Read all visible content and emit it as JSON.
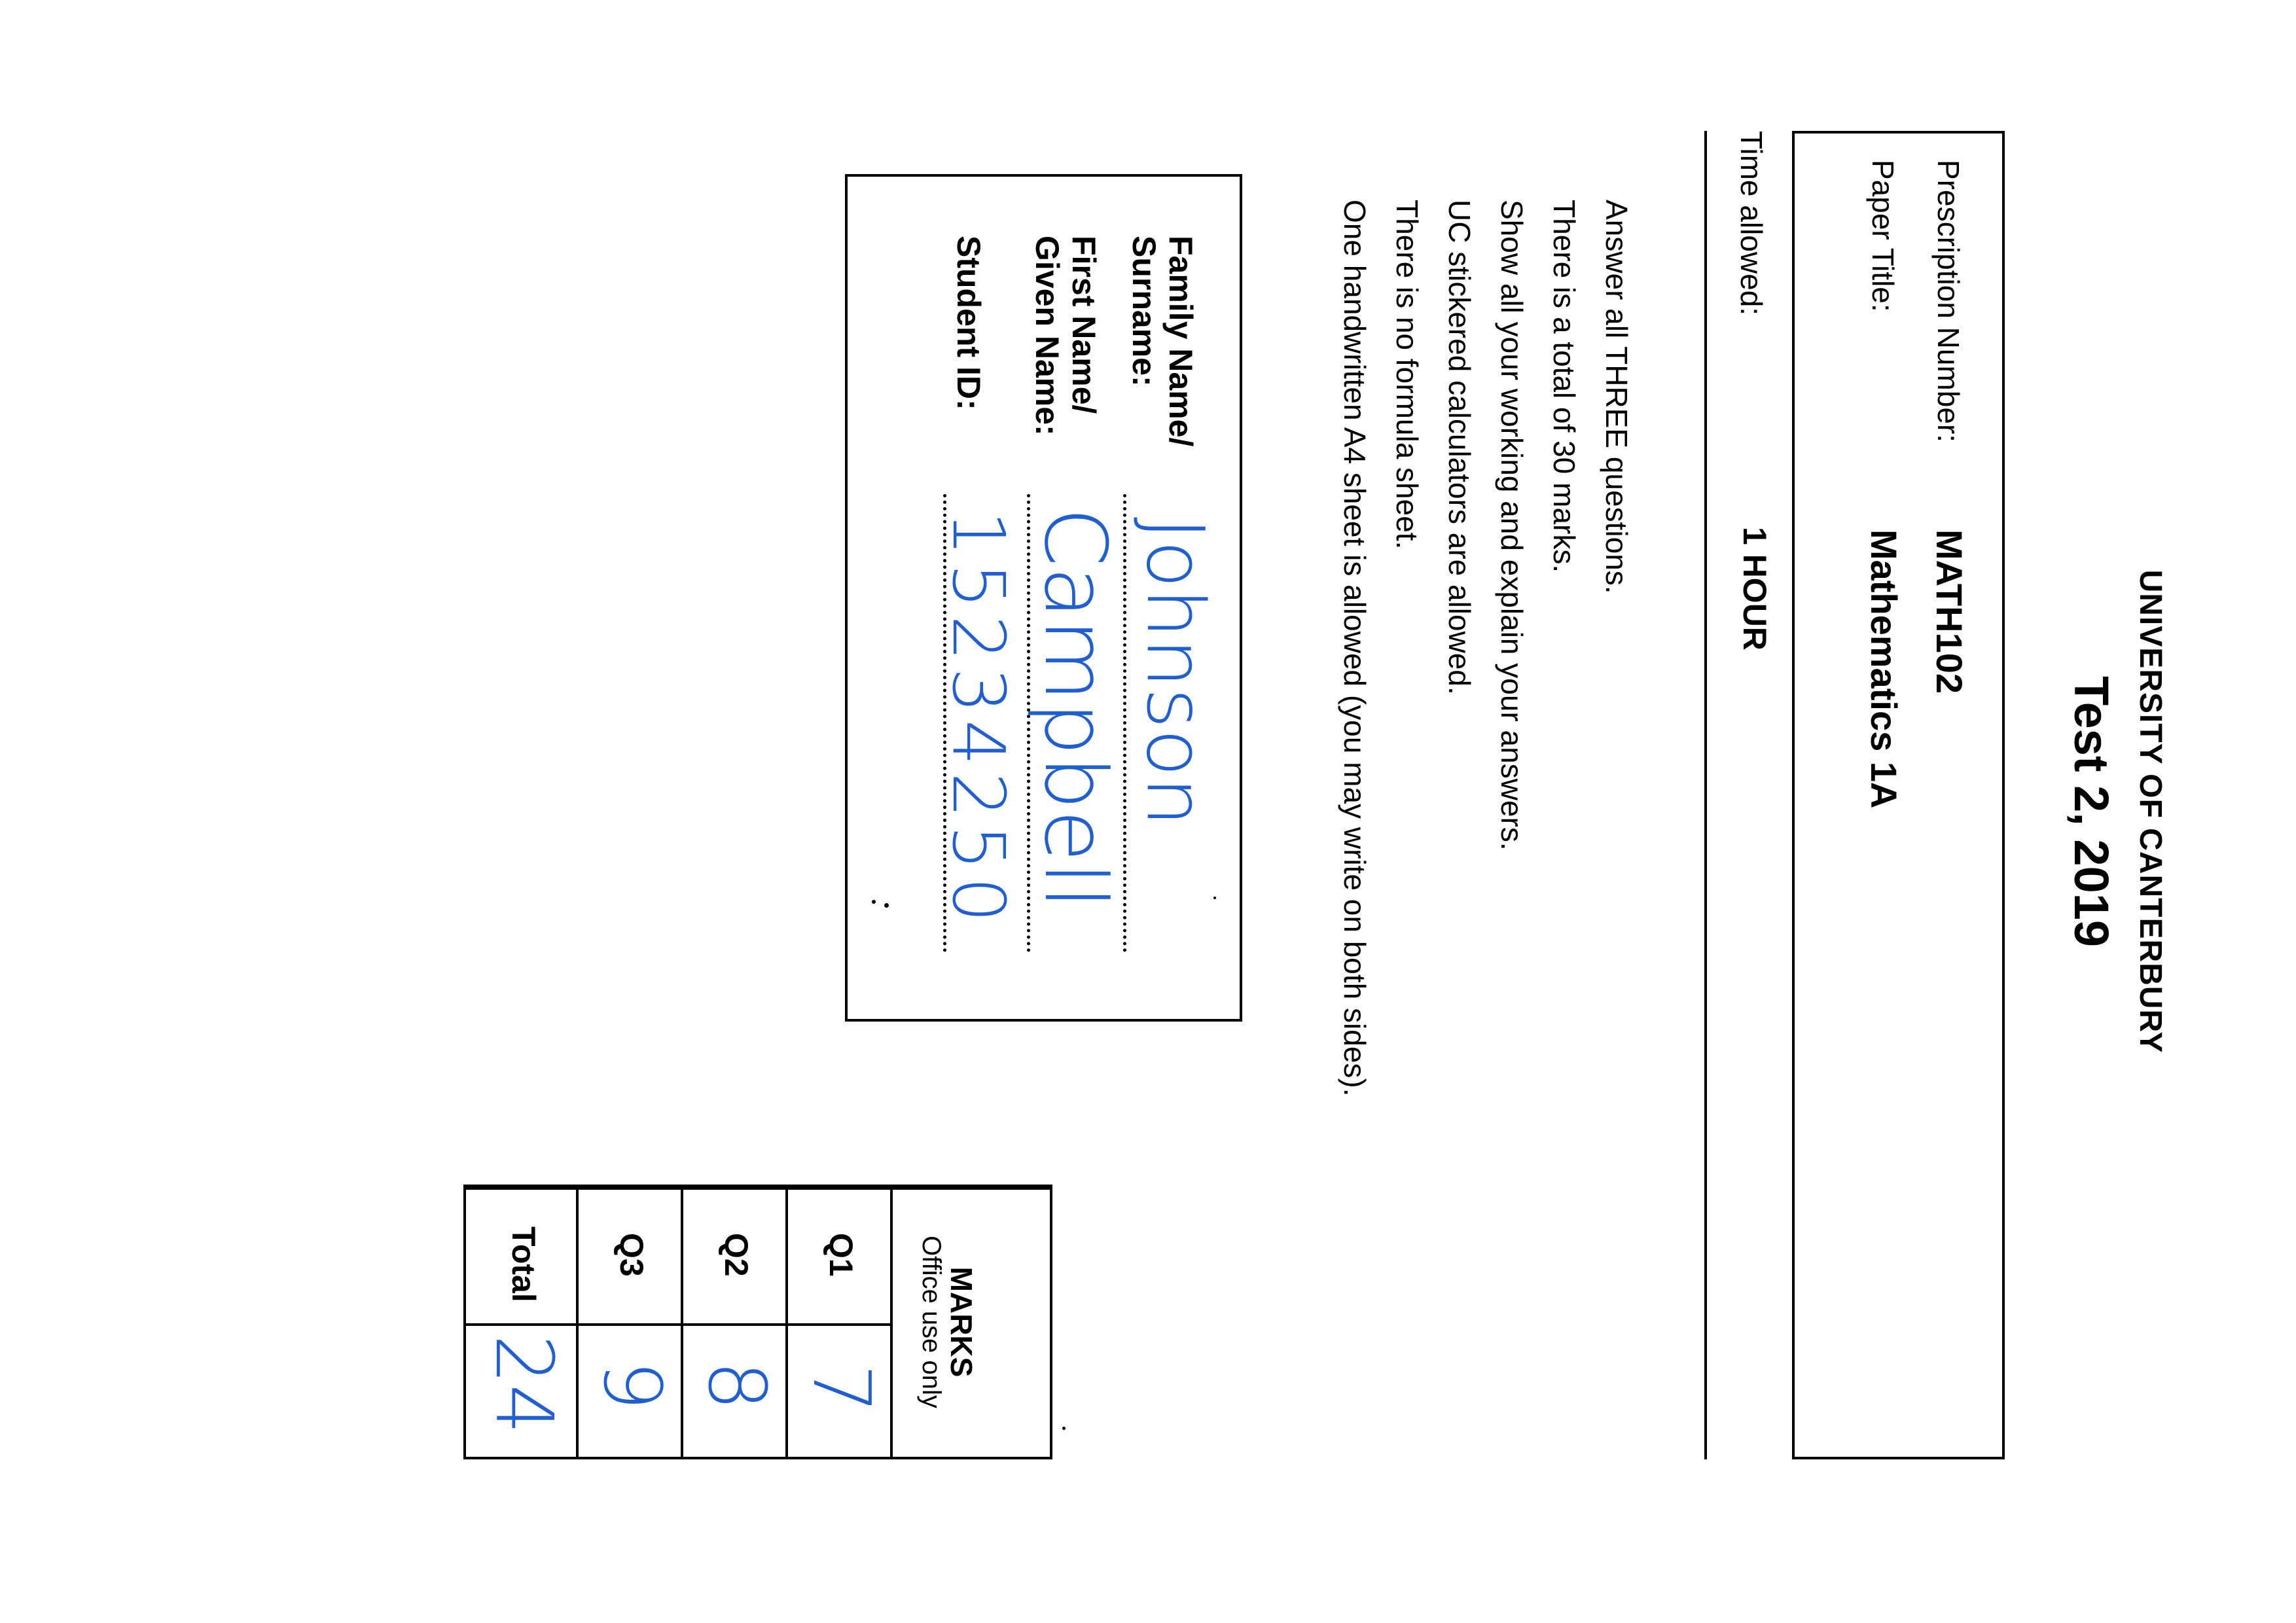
{
  "header": {
    "institution": "UNIVERSITY OF CANTERBURY",
    "test_title": "Test 2, 2019"
  },
  "course": {
    "prescription_label": "Prescription Number:",
    "prescription_value": "MATH102",
    "paper_title_label": "Paper Title:",
    "paper_title_value": "Mathematics 1A"
  },
  "time": {
    "label": "Time allowed:",
    "value": "1 HOUR"
  },
  "instructions": [
    "Answer all THREE questions.",
    "There is a total of 30 marks.",
    "Show all your working and explain your answers.",
    "UC stickered calculators are allowed.",
    "There is no formula sheet.",
    "One handwritten A4 sheet is allowed (you may write on both sides)."
  ],
  "student": {
    "family_label_1": "Family Name/",
    "family_label_2": "Surname:",
    "family_value": "Johnson",
    "first_label_1": "First Name/",
    "first_label_2": "Given Name:",
    "first_value": "Campbell",
    "id_label": "Student ID:",
    "id_value": "15234250"
  },
  "marks": {
    "title": "MARKS",
    "subtitle": "Office use only",
    "rows": [
      {
        "label": "Q1",
        "value": "7"
      },
      {
        "label": "Q2",
        "value": "8"
      },
      {
        "label": "Q3",
        "value": "9"
      },
      {
        "label": "Total",
        "value": "24"
      }
    ]
  },
  "colors": {
    "ink": "#000000",
    "handwriting": "#1f5fd1",
    "paper": "#ffffff"
  }
}
